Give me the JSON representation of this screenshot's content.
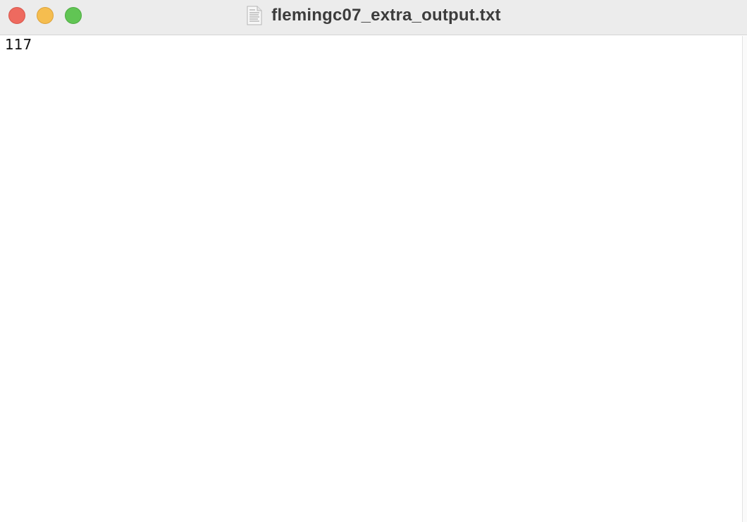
{
  "window": {
    "title": "flemingc07_extra_output.txt",
    "title_icon": "text-document-icon"
  },
  "controls": {
    "close_color": "#ee6a5f",
    "minimize_color": "#f5bd4f",
    "zoom_color": "#61c554"
  },
  "document": {
    "lines": [
      "117"
    ]
  }
}
